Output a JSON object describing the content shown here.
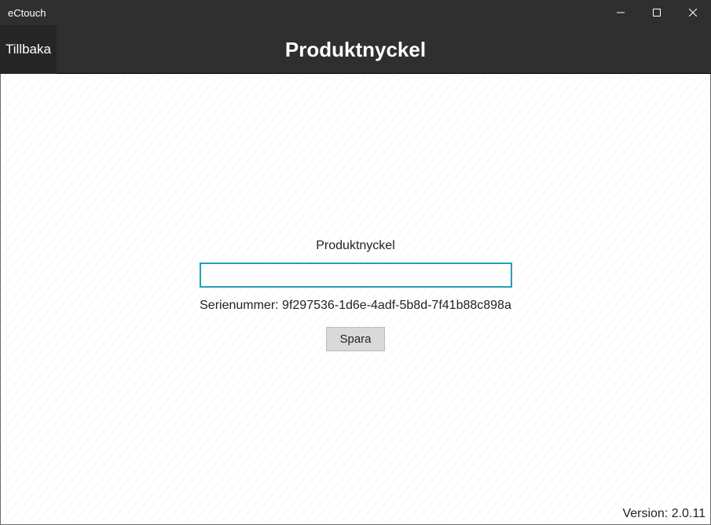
{
  "window": {
    "title": "eCtouch"
  },
  "header": {
    "back_label": "Tillbaka",
    "page_title": "Produktnyckel"
  },
  "form": {
    "field_label": "Produktnyckel",
    "input_value": "",
    "serial_line": "Serienummer: 9f297536-1d6e-4adf-5b8d-7f41b88c898a",
    "save_label": "Spara"
  },
  "footer": {
    "version_label": "Version: 2.0.11"
  }
}
